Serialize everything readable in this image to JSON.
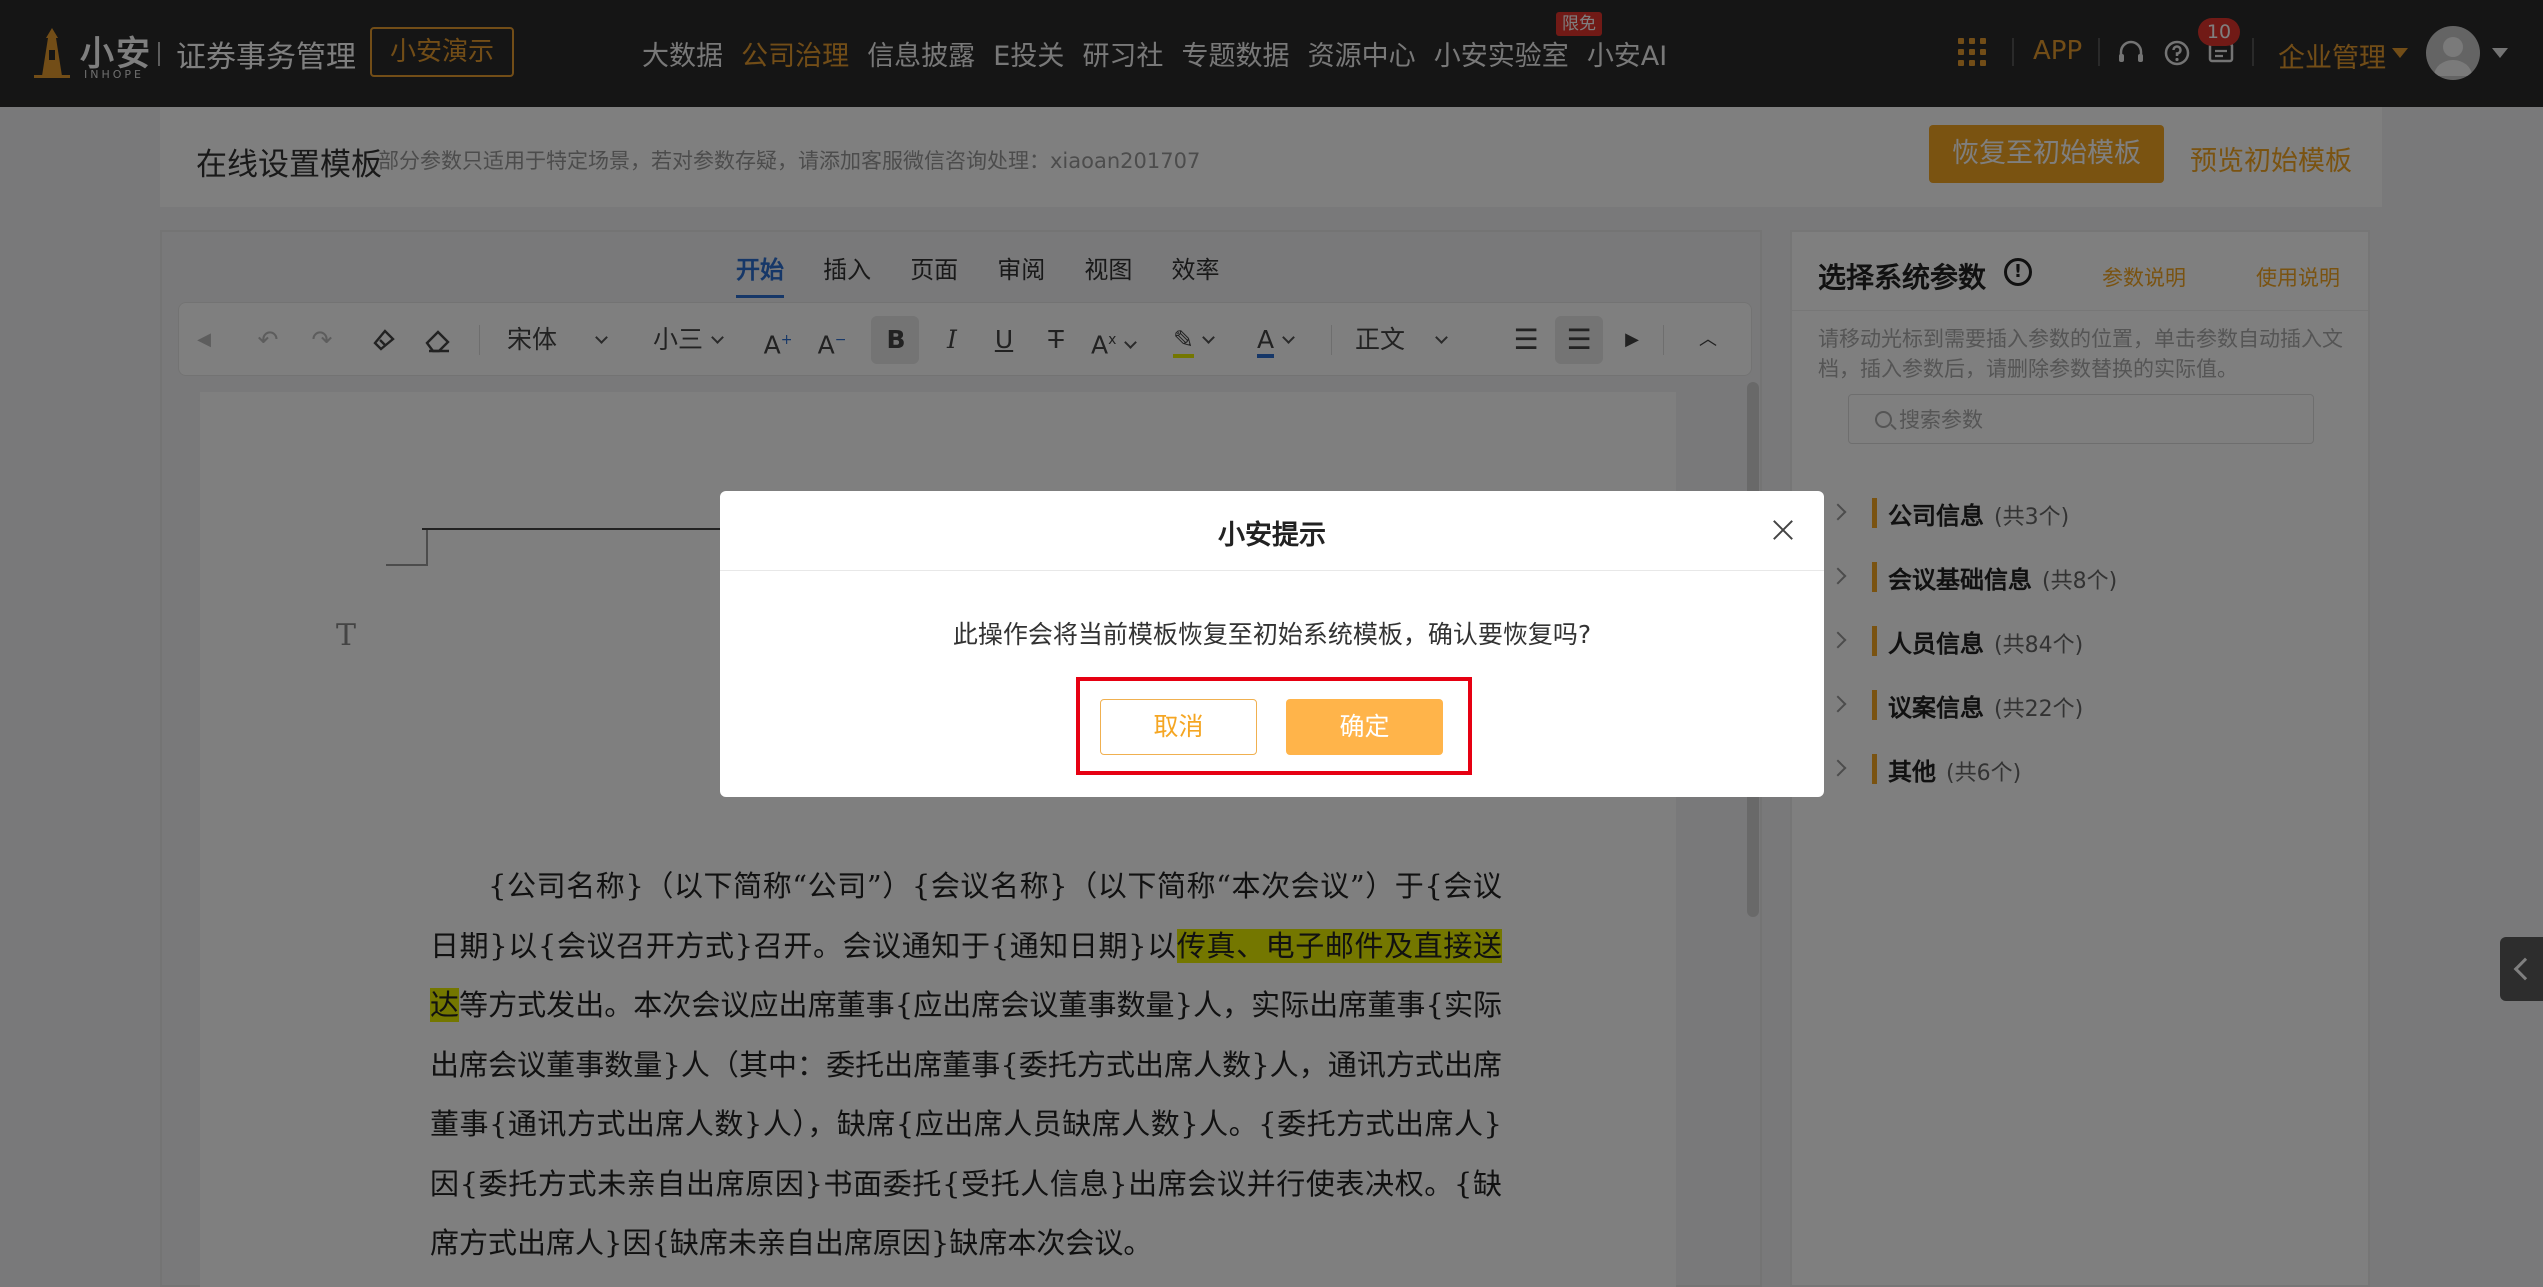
{
  "brand": {
    "logo_cn": "小安",
    "logo_en": "INHOPE",
    "app_title": "证券事务管理",
    "demo_label": "小安演示"
  },
  "nav": {
    "items": [
      "大数据",
      "公司治理",
      "信息披露",
      "E投关",
      "研习社",
      "专题数据",
      "资源中心",
      "小安实验室",
      "小安AI"
    ],
    "active": "公司治理",
    "promo_badge": "限免"
  },
  "header_tools": {
    "app_label": "APP",
    "notification_count": "10",
    "enterprise_label": "企业管理",
    "accent_color": "#e49a2e"
  },
  "page": {
    "title": "在线设置模板",
    "hint": "部分参数只适用于特定场景，若对参数存疑，请添加客服微信咨询处理：xiaoan201707",
    "restore_button": "恢复至初始模板",
    "preview_link": "预览初始模板"
  },
  "editor": {
    "tabs": [
      "开始",
      "插入",
      "页面",
      "审阅",
      "视图",
      "效率"
    ],
    "active_tab": "开始",
    "font_name": "宋体",
    "font_size": "小三",
    "paragraph_style": "正文",
    "body_text_1": "{公司名称}（以下简称“公司”）{会议名称}（以下简称“本次会议”）于{会议日期}以{会议召开方式}召开。会议通知于{通知日期}以",
    "body_highlight": "传真、电子邮件及直接送达",
    "body_text_2": "等方式发出。本次会议应出席董事{应出席会议董事数量}人，实际出席董事{实际出席会议董事数量}人（其中：委托出席董事{委托方式出席人数}人，通讯方式出席董事{通讯方式出席人数}人），缺席{应出席人员缺席人数}人。{委托方式出席人}因{委托方式未亲自出席原因}书面委托{受托人信息}出席会议并行使表决权。{缺席方式出席人}因{缺席未亲自出席原因}缺席本次会议。",
    "highlight_color": "#e8ef00"
  },
  "side_panel": {
    "title": "选择系统参数",
    "param_help": "参数说明",
    "usage_help": "使用说明",
    "hint": "请移动光标到需要插入参数的位置，单击参数自动插入文档，插入参数后，请删除参数替换的实际值。",
    "search_placeholder": "搜索参数",
    "groups": [
      {
        "label": "公司信息",
        "count": "(共3个)"
      },
      {
        "label": "会议基础信息",
        "count": "(共8个)"
      },
      {
        "label": "人员信息",
        "count": "(共84个)"
      },
      {
        "label": "议案信息",
        "count": "(共22个)"
      },
      {
        "label": "其他",
        "count": "(共6个)"
      }
    ]
  },
  "dialog": {
    "title": "小安提示",
    "message": "此操作会将当前模板恢复至初始系统模板，确认要恢复吗?",
    "cancel_label": "取消",
    "confirm_label": "确定",
    "confirm_color": "#ffb44a",
    "frame_color": "#e60012"
  }
}
